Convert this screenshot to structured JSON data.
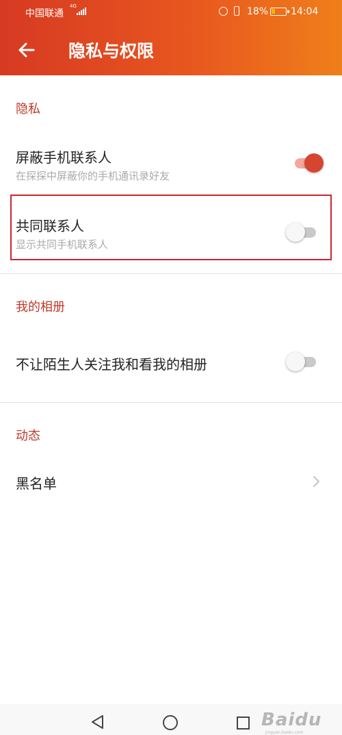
{
  "status_bar": {
    "carrier": "中国联通",
    "network": "4G",
    "battery": "18%",
    "time": "14:04"
  },
  "header": {
    "title": "隐私与权限"
  },
  "sections": {
    "privacy": {
      "label": "隐私",
      "block_contacts": {
        "title": "屏蔽手机联系人",
        "subtitle": "在探探中屏蔽你的手机通讯录好友",
        "enabled": true
      },
      "mutual_contacts": {
        "title": "共同联系人",
        "subtitle": "显示共同手机联系人",
        "enabled": false
      }
    },
    "album": {
      "label": "我的相册",
      "stranger_album": {
        "title": "不让陌生人关注我和看我的相册",
        "enabled": false
      }
    },
    "moments": {
      "label": "动态",
      "blacklist": {
        "title": "黑名单"
      }
    }
  },
  "watermark": {
    "text": "Baidu",
    "sub": "jingyan.baidu.com"
  },
  "colors": {
    "accent": "#d64531",
    "header_start": "#d63a22",
    "header_end": "#ef7f1a",
    "highlight": "#d0232d"
  }
}
